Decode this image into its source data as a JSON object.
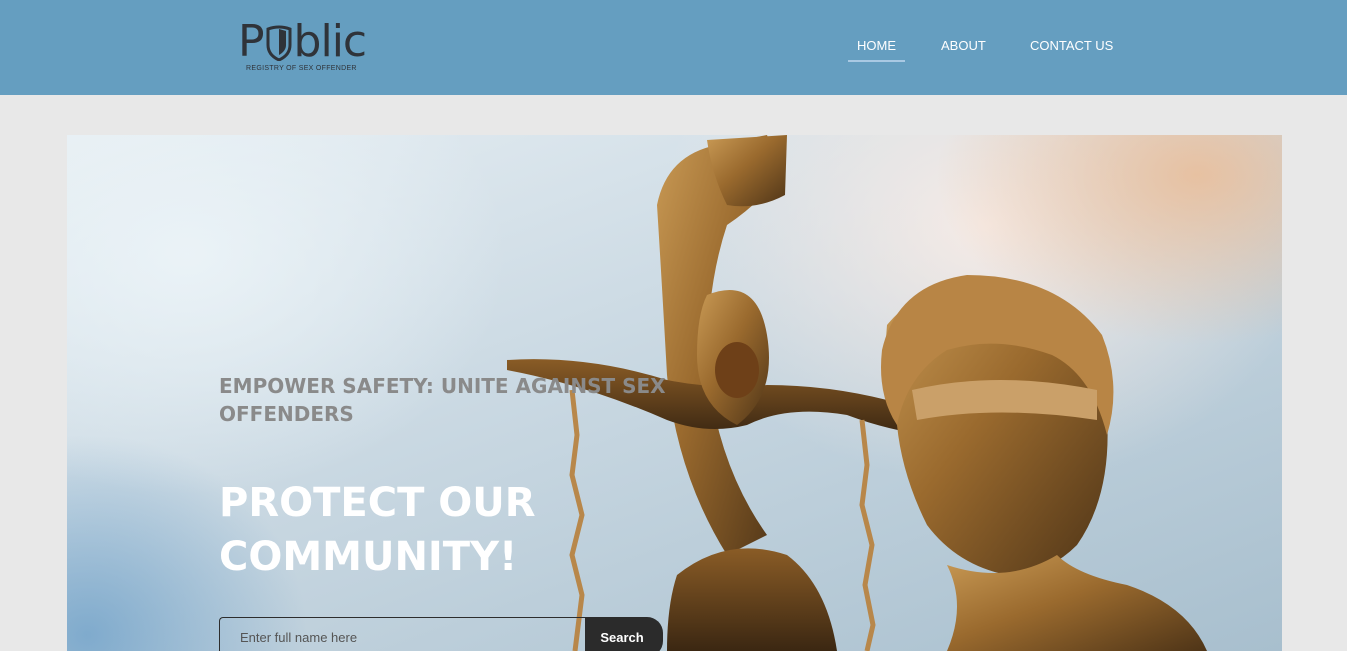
{
  "header": {
    "logo": {
      "word_start": "P",
      "word_end": "blic",
      "subtitle": "REGISTRY OF SEX OFFENDER"
    },
    "nav": [
      {
        "label": "HOME",
        "active": true
      },
      {
        "label": "ABOUT",
        "active": false
      },
      {
        "label": "CONTACT US",
        "active": false
      }
    ]
  },
  "hero": {
    "subtitle": "EMPOWER SAFETY: UNITE AGAINST SEX OFFENDERS",
    "title": "PROTECT OUR COMMUNITY!",
    "image": "lady-justice-statue"
  },
  "search": {
    "placeholder": "Enter full name here",
    "button_label": "Search"
  },
  "colors": {
    "header_bg": "#659ec0",
    "page_bg": "#e8e8e8",
    "button_bg": "#2b2b2b",
    "logo_text": "#2f3339"
  }
}
